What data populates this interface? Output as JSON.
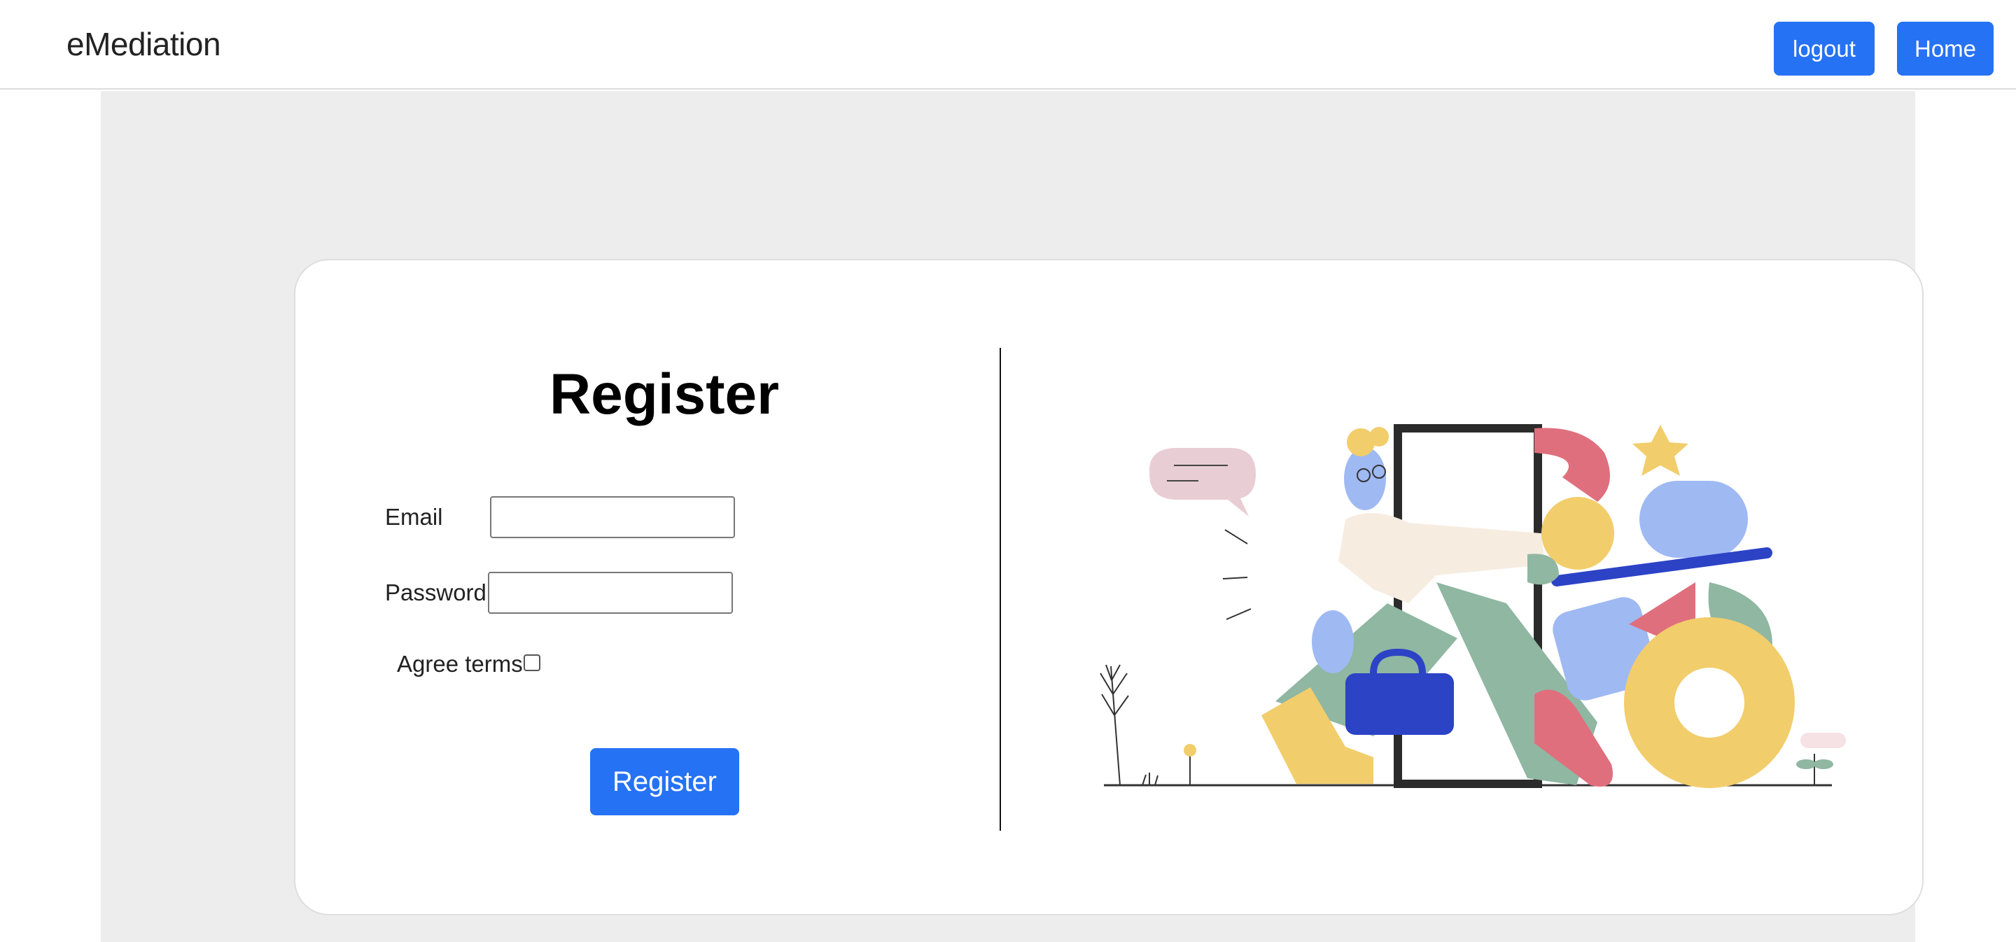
{
  "navbar": {
    "brand": "eMediation",
    "logout_label": "logout",
    "home_label": "Home"
  },
  "form": {
    "title": "Register",
    "email_label": "Email",
    "email_value": "",
    "password_label": "Password",
    "password_value": "",
    "agree_label": "Agree terms",
    "agree_checked": false,
    "submit_label": "Register"
  },
  "illustration": {
    "icon": "person-walking-through-door-illustration"
  },
  "colors": {
    "primary": "#2672f4",
    "page_background": "#ededed",
    "card_background": "#ffffff"
  }
}
